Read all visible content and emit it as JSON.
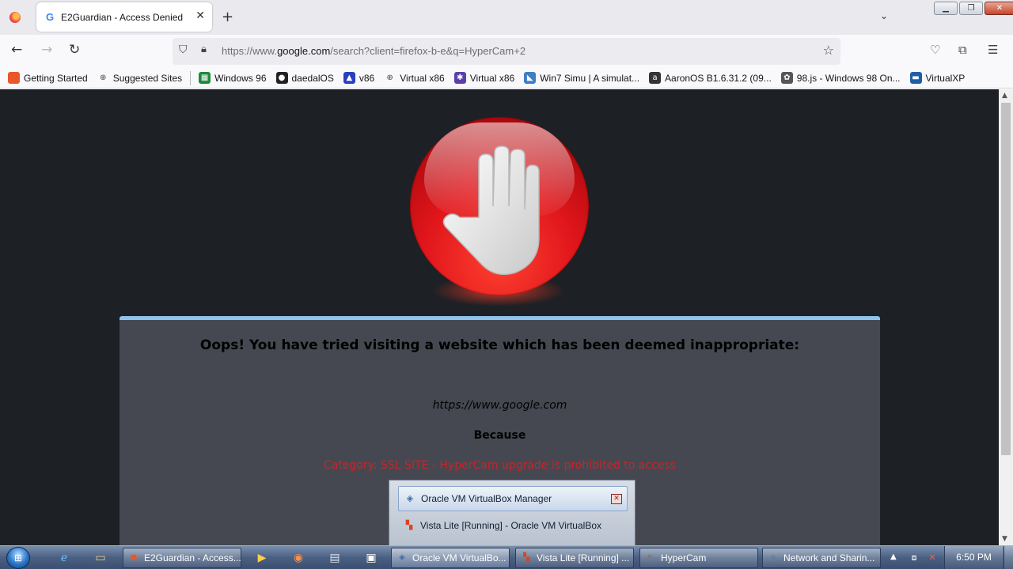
{
  "browser": {
    "tab": {
      "title": "E2Guardian - Access Denied",
      "favicon": "G"
    },
    "new_tab_icon": "plus-icon",
    "url": {
      "scheme": "https://www.",
      "domain": "google.com",
      "path": "/search?client=firefox-b-e&q=HyperCam+2"
    }
  },
  "bookmarks": [
    {
      "label": "Getting Started",
      "icon": "firefox-icon",
      "color": "#e8562a",
      "glyph": ""
    },
    {
      "label": "Suggested Sites",
      "icon": "globe-icon",
      "color": "transparent",
      "glyph": "⊕"
    },
    {
      "label": "Windows 96",
      "icon": "windows96-icon",
      "color": "#1b8a3a",
      "glyph": "▦"
    },
    {
      "label": "daedalOS",
      "icon": "daedalos-icon",
      "color": "#222222",
      "glyph": "●"
    },
    {
      "label": "v86",
      "icon": "v86-icon",
      "color": "#2a3fbf",
      "glyph": "▲"
    },
    {
      "label": "Virtual x86",
      "icon": "globe-icon",
      "color": "transparent",
      "glyph": "⊕"
    },
    {
      "label": "Virtual x86",
      "icon": "bug-icon",
      "color": "#5b3fa8",
      "glyph": "✱"
    },
    {
      "label": "Win7 Simu | A simulat...",
      "icon": "win7simu-icon",
      "color": "#3d7fc4",
      "glyph": "◣"
    },
    {
      "label": "AaronOS B1.6.31.2 (09...",
      "icon": "aaronos-icon",
      "color": "#333333",
      "glyph": "a"
    },
    {
      "label": "98.js - Windows 98 On...",
      "icon": "98js-icon",
      "color": "#555555",
      "glyph": "✿"
    },
    {
      "label": "VirtualXP",
      "icon": "virtualxp-icon",
      "color": "#1f5fa8",
      "glyph": "▬"
    }
  ],
  "page": {
    "heading": "Oops! You have tried visiting a website which has been deemed inappropriate:",
    "blocked_url": "https://www.google.com",
    "because_label": "Because",
    "reason": "Category: SSL SITE - HyperCam upgrade is prohibited to access"
  },
  "taskbar_popup": {
    "items": [
      {
        "label": "Oracle VM VirtualBox Manager",
        "icon": "virtualbox-icon",
        "glyph": "◈",
        "color": "#3b6ea5"
      },
      {
        "label": "Vista Lite [Running] - Oracle VM VirtualBox",
        "icon": "windows-flag-icon",
        "glyph": "▚",
        "color": "#d9441f"
      }
    ],
    "close_glyph": "✕"
  },
  "taskbar": {
    "buttons": [
      {
        "label": "E2Guardian - Access...",
        "icon": "firefox-icon",
        "glyph": "●",
        "color": "#e8562a",
        "active": false
      },
      {
        "label": "Oracle VM VirtualBo...",
        "icon": "virtualbox-icon",
        "glyph": "◈",
        "color": "#3b6ea5",
        "active": true
      },
      {
        "label": "Vista Lite [Running] ...",
        "icon": "windows-flag-icon",
        "glyph": "▚",
        "color": "#d9441f",
        "active": false
      },
      {
        "label": "HyperCam",
        "icon": "hypercam-icon",
        "glyph": "◐",
        "color": "#7a7a7a",
        "active": false
      },
      {
        "label": "Network and Sharin...",
        "icon": "network-icon",
        "glyph": "⁘",
        "color": "#2e5fa8",
        "active": false
      }
    ],
    "clock": "6:50 PM"
  },
  "colors": {
    "accent": "#8fc3ec",
    "reason_red": "#c9242b",
    "page_bg": "#1d2024",
    "panel_bg": "#454850"
  }
}
